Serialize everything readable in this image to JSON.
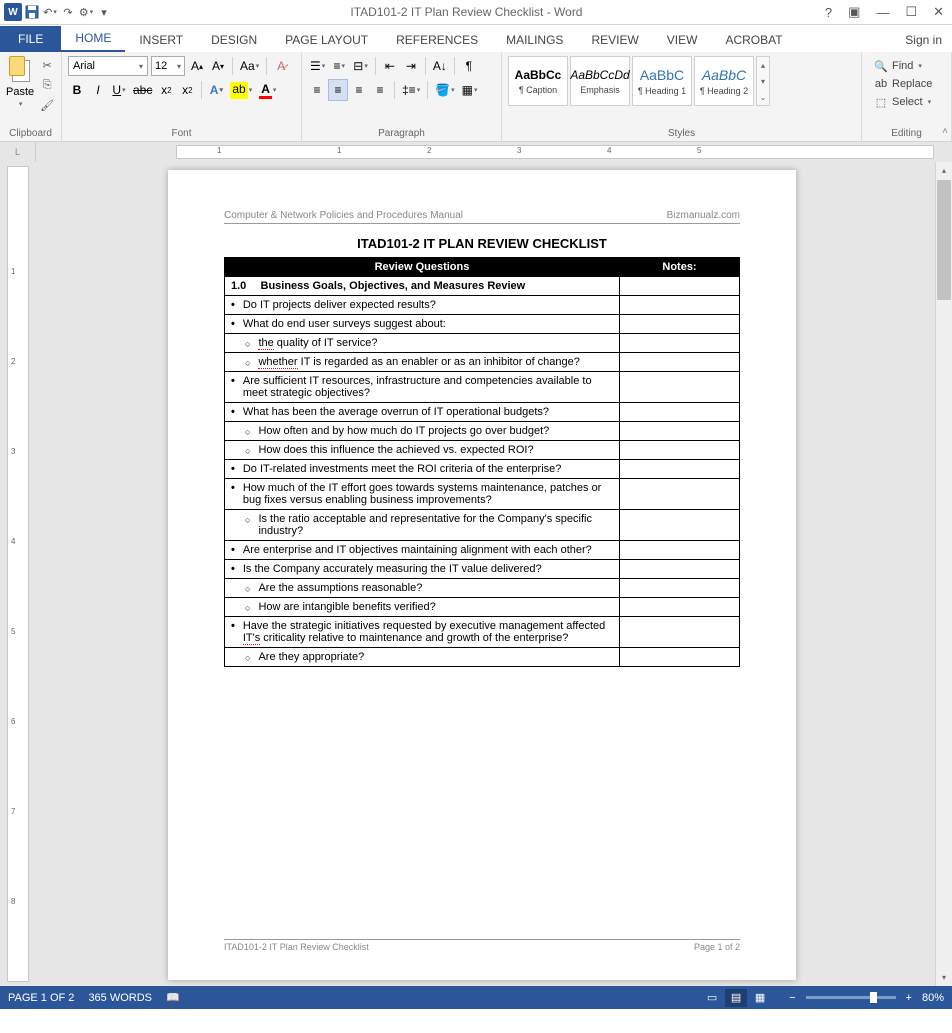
{
  "titlebar": {
    "title": "ITAD101-2 IT Plan Review Checklist - Word"
  },
  "tabs": {
    "file": "FILE",
    "home": "HOME",
    "insert": "INSERT",
    "design": "DESIGN",
    "page_layout": "PAGE LAYOUT",
    "references": "REFERENCES",
    "mailings": "MAILINGS",
    "review": "REVIEW",
    "view": "VIEW",
    "acrobat": "ACROBAT",
    "signin": "Sign in"
  },
  "ribbon": {
    "clipboard": {
      "label": "Clipboard",
      "paste": "Paste"
    },
    "font": {
      "label": "Font",
      "name": "Arial",
      "size": "12"
    },
    "paragraph": {
      "label": "Paragraph"
    },
    "styles": {
      "label": "Styles",
      "items": [
        {
          "prev": "AaBbCc",
          "name": "¶ Caption"
        },
        {
          "prev": "AaBbCcDd",
          "name": "Emphasis"
        },
        {
          "prev": "AaBbC",
          "name": "¶ Heading 1"
        },
        {
          "prev": "AaBbC",
          "name": "¶ Heading 2"
        }
      ]
    },
    "editing": {
      "label": "Editing",
      "find": "Find",
      "replace": "Replace",
      "select": "Select"
    }
  },
  "doc": {
    "hdr_left": "Computer & Network Policies and Procedures Manual",
    "hdr_right": "Bizmanualz.com",
    "title": "ITAD101-2   IT PLAN REVIEW CHECKLIST",
    "col1": "Review Questions",
    "col2": "Notes:",
    "sec_num": "1.0",
    "sec_title": "Business Goals, Objectives, and Measures Review",
    "rows": [
      {
        "t": "b",
        "txt": "Do IT projects deliver expected results?"
      },
      {
        "t": "b",
        "txt": "What do end user surveys suggest about:"
      },
      {
        "t": "s",
        "pre": "the",
        "txt": " quality of IT service?"
      },
      {
        "t": "s",
        "pre": "whether",
        "txt": " IT is regarded as an enabler or as an inhibitor of change?"
      },
      {
        "t": "b",
        "txt": "Are sufficient IT resources, infrastructure and competencies available to meet strategic objectives?"
      },
      {
        "t": "b",
        "txt": "What has been the average overrun of IT operational budgets?"
      },
      {
        "t": "s",
        "txt": "How often and by how much do IT projects go over budget?"
      },
      {
        "t": "s",
        "txt": "How does this influence the achieved vs. expected ROI?"
      },
      {
        "t": "b",
        "txt": "Do IT-related investments meet the ROI criteria of the enterprise?"
      },
      {
        "t": "b",
        "txt": "How much of the IT effort goes towards systems maintenance, patches or bug fixes versus enabling business improvements?"
      },
      {
        "t": "s",
        "txt": "Is the ratio acceptable and representative for the Company's specific industry?"
      },
      {
        "t": "b",
        "txt": "Are enterprise and IT objectives maintaining alignment with each other?"
      },
      {
        "t": "b",
        "txt": "Is the Company accurately measuring the IT value delivered?"
      },
      {
        "t": "s",
        "txt": "Are the assumptions reasonable?"
      },
      {
        "t": "s",
        "txt": "How are intangible benefits verified?"
      },
      {
        "t": "b",
        "txt_parts": [
          "Have the strategic initiatives requested by executive management affected ",
          "IT's",
          " criticality relative to maintenance and growth of the enterprise?"
        ]
      },
      {
        "t": "s",
        "txt": "Are they appropriate?"
      }
    ],
    "ftr_left": "ITAD101-2 IT Plan Review Checklist",
    "ftr_right": "Page 1 of 2"
  },
  "status": {
    "page": "PAGE 1 OF 2",
    "words": "365 WORDS",
    "zoom": "80%"
  }
}
